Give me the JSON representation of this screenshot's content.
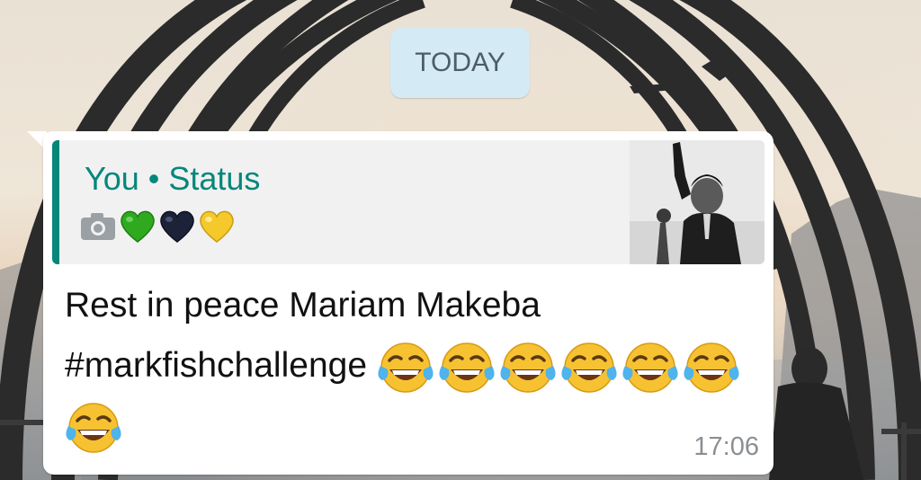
{
  "chat": {
    "date_label": "TODAY",
    "message": {
      "quote": {
        "title": "You • Status",
        "camera_icon": "camera-icon",
        "hearts": [
          "green-heart-icon",
          "black-heart-icon",
          "yellow-heart-icon"
        ],
        "thumbnail": "status-photo-thumbnail"
      },
      "line1": "Rest in peace Mariam Makeba",
      "line2": "#markfishchallenge",
      "emoji": "tears-of-joy-emoji",
      "emoji_count": 7,
      "time": "17:06"
    }
  },
  "colors": {
    "accent": "#05877a",
    "date_chip_bg": "#d4eaf4",
    "bubble_bg": "#ffffff"
  }
}
